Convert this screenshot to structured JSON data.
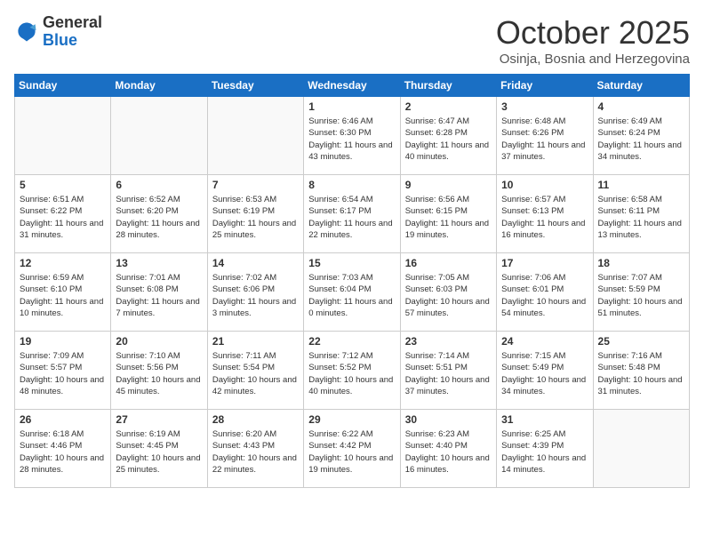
{
  "logo": {
    "general": "General",
    "blue": "Blue"
  },
  "header": {
    "month": "October 2025",
    "location": "Osinja, Bosnia and Herzegovina"
  },
  "weekdays": [
    "Sunday",
    "Monday",
    "Tuesday",
    "Wednesday",
    "Thursday",
    "Friday",
    "Saturday"
  ],
  "weeks": [
    [
      {
        "day": "",
        "info": ""
      },
      {
        "day": "",
        "info": ""
      },
      {
        "day": "",
        "info": ""
      },
      {
        "day": "1",
        "info": "Sunrise: 6:46 AM\nSunset: 6:30 PM\nDaylight: 11 hours\nand 43 minutes."
      },
      {
        "day": "2",
        "info": "Sunrise: 6:47 AM\nSunset: 6:28 PM\nDaylight: 11 hours\nand 40 minutes."
      },
      {
        "day": "3",
        "info": "Sunrise: 6:48 AM\nSunset: 6:26 PM\nDaylight: 11 hours\nand 37 minutes."
      },
      {
        "day": "4",
        "info": "Sunrise: 6:49 AM\nSunset: 6:24 PM\nDaylight: 11 hours\nand 34 minutes."
      }
    ],
    [
      {
        "day": "5",
        "info": "Sunrise: 6:51 AM\nSunset: 6:22 PM\nDaylight: 11 hours\nand 31 minutes."
      },
      {
        "day": "6",
        "info": "Sunrise: 6:52 AM\nSunset: 6:20 PM\nDaylight: 11 hours\nand 28 minutes."
      },
      {
        "day": "7",
        "info": "Sunrise: 6:53 AM\nSunset: 6:19 PM\nDaylight: 11 hours\nand 25 minutes."
      },
      {
        "day": "8",
        "info": "Sunrise: 6:54 AM\nSunset: 6:17 PM\nDaylight: 11 hours\nand 22 minutes."
      },
      {
        "day": "9",
        "info": "Sunrise: 6:56 AM\nSunset: 6:15 PM\nDaylight: 11 hours\nand 19 minutes."
      },
      {
        "day": "10",
        "info": "Sunrise: 6:57 AM\nSunset: 6:13 PM\nDaylight: 11 hours\nand 16 minutes."
      },
      {
        "day": "11",
        "info": "Sunrise: 6:58 AM\nSunset: 6:11 PM\nDaylight: 11 hours\nand 13 minutes."
      }
    ],
    [
      {
        "day": "12",
        "info": "Sunrise: 6:59 AM\nSunset: 6:10 PM\nDaylight: 11 hours\nand 10 minutes."
      },
      {
        "day": "13",
        "info": "Sunrise: 7:01 AM\nSunset: 6:08 PM\nDaylight: 11 hours\nand 7 minutes."
      },
      {
        "day": "14",
        "info": "Sunrise: 7:02 AM\nSunset: 6:06 PM\nDaylight: 11 hours\nand 3 minutes."
      },
      {
        "day": "15",
        "info": "Sunrise: 7:03 AM\nSunset: 6:04 PM\nDaylight: 11 hours\nand 0 minutes."
      },
      {
        "day": "16",
        "info": "Sunrise: 7:05 AM\nSunset: 6:03 PM\nDaylight: 10 hours\nand 57 minutes."
      },
      {
        "day": "17",
        "info": "Sunrise: 7:06 AM\nSunset: 6:01 PM\nDaylight: 10 hours\nand 54 minutes."
      },
      {
        "day": "18",
        "info": "Sunrise: 7:07 AM\nSunset: 5:59 PM\nDaylight: 10 hours\nand 51 minutes."
      }
    ],
    [
      {
        "day": "19",
        "info": "Sunrise: 7:09 AM\nSunset: 5:57 PM\nDaylight: 10 hours\nand 48 minutes."
      },
      {
        "day": "20",
        "info": "Sunrise: 7:10 AM\nSunset: 5:56 PM\nDaylight: 10 hours\nand 45 minutes."
      },
      {
        "day": "21",
        "info": "Sunrise: 7:11 AM\nSunset: 5:54 PM\nDaylight: 10 hours\nand 42 minutes."
      },
      {
        "day": "22",
        "info": "Sunrise: 7:12 AM\nSunset: 5:52 PM\nDaylight: 10 hours\nand 40 minutes."
      },
      {
        "day": "23",
        "info": "Sunrise: 7:14 AM\nSunset: 5:51 PM\nDaylight: 10 hours\nand 37 minutes."
      },
      {
        "day": "24",
        "info": "Sunrise: 7:15 AM\nSunset: 5:49 PM\nDaylight: 10 hours\nand 34 minutes."
      },
      {
        "day": "25",
        "info": "Sunrise: 7:16 AM\nSunset: 5:48 PM\nDaylight: 10 hours\nand 31 minutes."
      }
    ],
    [
      {
        "day": "26",
        "info": "Sunrise: 6:18 AM\nSunset: 4:46 PM\nDaylight: 10 hours\nand 28 minutes."
      },
      {
        "day": "27",
        "info": "Sunrise: 6:19 AM\nSunset: 4:45 PM\nDaylight: 10 hours\nand 25 minutes."
      },
      {
        "day": "28",
        "info": "Sunrise: 6:20 AM\nSunset: 4:43 PM\nDaylight: 10 hours\nand 22 minutes."
      },
      {
        "day": "29",
        "info": "Sunrise: 6:22 AM\nSunset: 4:42 PM\nDaylight: 10 hours\nand 19 minutes."
      },
      {
        "day": "30",
        "info": "Sunrise: 6:23 AM\nSunset: 4:40 PM\nDaylight: 10 hours\nand 16 minutes."
      },
      {
        "day": "31",
        "info": "Sunrise: 6:25 AM\nSunset: 4:39 PM\nDaylight: 10 hours\nand 14 minutes."
      },
      {
        "day": "",
        "info": ""
      }
    ]
  ]
}
